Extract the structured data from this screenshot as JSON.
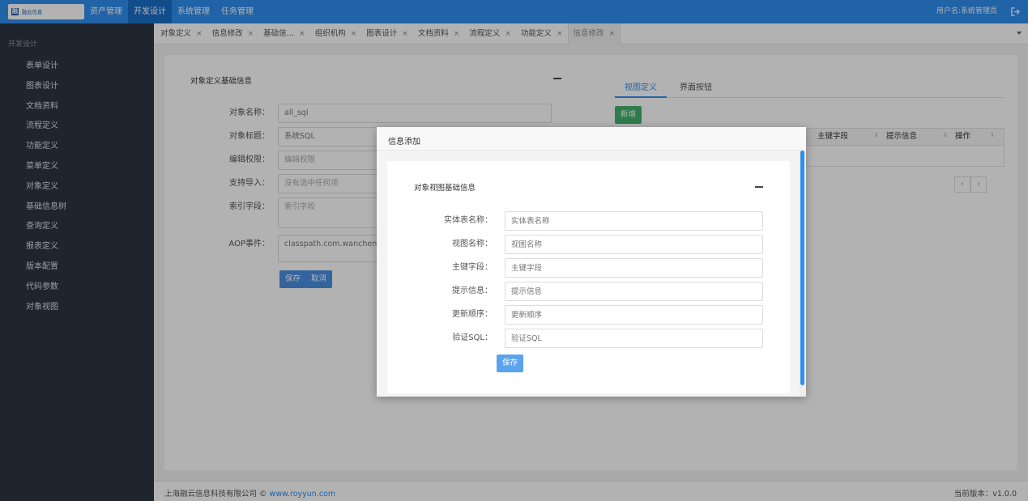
{
  "app": {
    "logo_mark": "融",
    "logo_text": "融云信息"
  },
  "topnav": [
    {
      "label": "资产管理",
      "active": false
    },
    {
      "label": "开发设计",
      "active": true
    },
    {
      "label": "系统管理",
      "active": false
    },
    {
      "label": "任务管理",
      "active": false
    }
  ],
  "user": {
    "label": "用户名:系统管理员"
  },
  "sidebar": {
    "group": "开发设计",
    "items": [
      "表单设计",
      "图表设计",
      "文档资料",
      "流程定义",
      "功能定义",
      "菜单定义",
      "对象定义",
      "基础信息树",
      "查询定义",
      "报表定义",
      "版本配置",
      "代码参数",
      "对象视图"
    ]
  },
  "tabs": [
    {
      "label": "对象定义",
      "close": "×"
    },
    {
      "label": "信息修改",
      "close": "×"
    },
    {
      "label": "基础信…",
      "close": "×"
    },
    {
      "label": "组织机构",
      "close": "×"
    },
    {
      "label": "图表设计",
      "close": "×"
    },
    {
      "label": "文档资料",
      "close": "×"
    },
    {
      "label": "流程定义",
      "close": "×"
    },
    {
      "label": "功能定义",
      "close": "×"
    },
    {
      "label": "信息修改",
      "close": "×"
    }
  ],
  "left_form": {
    "title": "对象定义基础信息",
    "fields": [
      {
        "label": "对象名称：",
        "value": "all_sql"
      },
      {
        "label": "对象标题：",
        "value": "系统SQL"
      },
      {
        "label": "编辑权限：",
        "value": "编辑权限"
      },
      {
        "label": "支持导入：",
        "value": "没有选中任何项"
      },
      {
        "label": "索引字段：",
        "value": "索引字段"
      },
      {
        "label": "AOP事件：",
        "value": "classpath.com.wancheng"
      }
    ],
    "save": "保存",
    "cancel": "取消"
  },
  "right_panel": {
    "tabs": [
      "视图定义",
      "界面按钮"
    ],
    "add": "新增",
    "columns": [
      "主键字段",
      "提示信息",
      "操作"
    ],
    "sort_icon": "⇕",
    "prev": "‹",
    "next": "›"
  },
  "modal": {
    "title": "信息添加",
    "section": "对象视图基础信息",
    "fields": [
      {
        "label": "实体表名称：",
        "placeholder": "实体表名称"
      },
      {
        "label": "视图名称：",
        "placeholder": "视图名称"
      },
      {
        "label": "主键字段：",
        "placeholder": "主键字段"
      },
      {
        "label": "提示信息：",
        "placeholder": "提示信息"
      },
      {
        "label": "更新顺序：",
        "placeholder": "更新顺序"
      },
      {
        "label": "验证SQL：",
        "placeholder": "验证SQL"
      }
    ],
    "save": "保存"
  },
  "footer": {
    "company": "上海融云信息科技有限公司 © ",
    "link": "www.royyun.com",
    "version": "当前版本：v1.0.0"
  }
}
